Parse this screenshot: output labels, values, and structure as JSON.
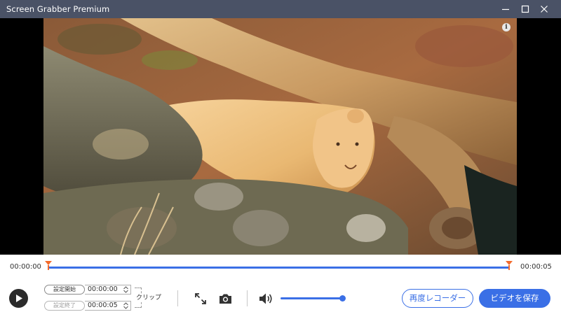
{
  "window": {
    "title": "Screen Grabber Premium"
  },
  "colors": {
    "titlebar": "#4a5266",
    "accent": "#3a6fe6",
    "handle": "#f36b2c"
  },
  "timeline": {
    "start_time": "00:00:00",
    "end_time": "00:00:05"
  },
  "clip": {
    "start_label": "設定開始",
    "start_value": "00:00:00",
    "end_label": "設定終了",
    "end_value": "00:00:05",
    "clip_label": "クリップ"
  },
  "volume": {
    "level": 1.0
  },
  "actions": {
    "rerecord_label": "再度レコーダー",
    "save_label": "ビデオを保存"
  },
  "icons": [
    "minimize-icon",
    "maximize-icon",
    "close-icon",
    "info-icon",
    "play-icon",
    "expand-icon",
    "camera-icon",
    "volume-icon"
  ]
}
